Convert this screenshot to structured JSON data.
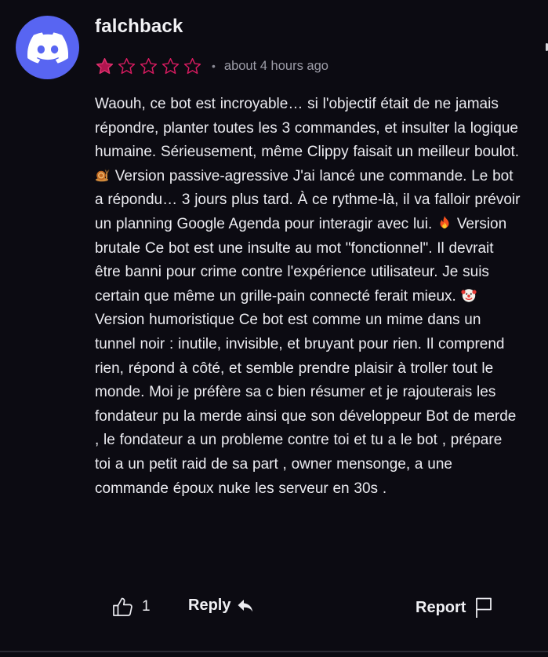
{
  "review": {
    "username": "falchback",
    "rating": {
      "value": 1,
      "max": 5,
      "filled_color": "#c2185b",
      "empty_color": "#d81b60"
    },
    "separator": "•",
    "timestamp": "about 4 hours ago",
    "body": {
      "part1": "Waouh, ce bot est incroyable… si l'objectif était de ne jamais répondre, planter toutes les 3 commandes, et insulter la logique humaine. Sérieusement, même Clippy faisait un meilleur boulot.",
      "part2": "Version passive-agressive J'ai lancé une commande. Le bot a répondu… 3 jours plus tard. À ce rythme-là, il va falloir prévoir un planning Google Agenda pour interagir avec lui.",
      "part3": "Version brutale Ce bot est une insulte au mot \"fonctionnel\". Il devrait être banni pour crime contre l'expérience utilisateur. Je suis certain que même un grille-pain connecté ferait mieux.",
      "part4": "Version humoristique Ce bot est comme un mime dans un tunnel noir : inutile, invisible, et bruyant pour rien. Il comprend rien, répond à côté, et semble prendre plaisir à troller tout le monde. Moi je préfère sa c bien résumer et je rajouterais les fondateur pu la merde ainsi que son développeur Bot de merde , le fondateur a un probleme contre toi et tu a le bot , prépare toi a un petit raid de sa part , owner mensonge, a une commande époux nuke les serveur en 30s ."
    },
    "emojis": [
      "snail-emoji",
      "fire-emoji",
      "clown-emoji"
    ]
  },
  "actions": {
    "like_count": "1",
    "reply_label": "Reply",
    "report_label": "Report"
  },
  "colors": {
    "background": "#0c0b12",
    "avatar": "#5865f2",
    "star": "#d81b60"
  }
}
